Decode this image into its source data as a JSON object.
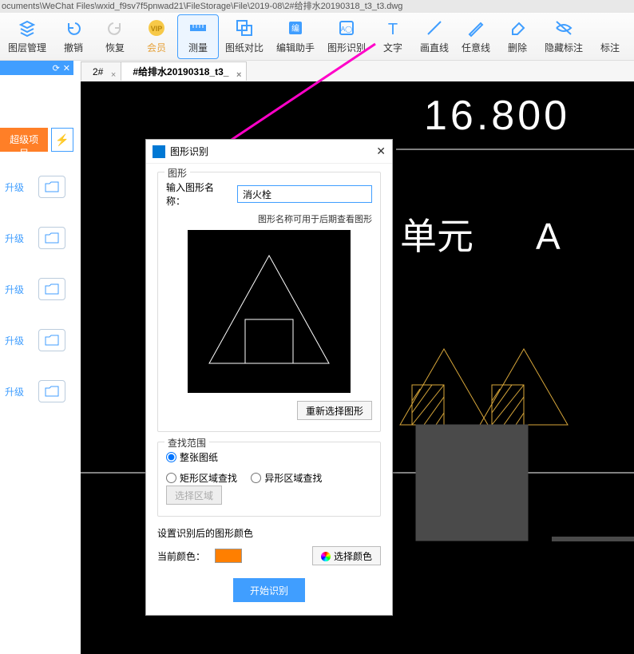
{
  "titlebar": "ocuments\\WeChat Files\\wxid_f9sv7f5pnwad21\\FileStorage\\File\\2019-08\\2#给排水20190318_t3_t3.dwg",
  "toolbar": {
    "layer": "图层管理",
    "undo": "撤销",
    "redo": "恢复",
    "vip": "会员",
    "measure": "测量",
    "compare": "图纸对比",
    "edit": "编辑助手",
    "recognize": "图形识别",
    "text": "文字",
    "line": "画直线",
    "freeline": "任意线",
    "delete": "删除",
    "hidenote": "隐藏标注",
    "mark": "标注"
  },
  "panel": {
    "pin": "📌",
    "close": "✕"
  },
  "side": {
    "super": "超级项目",
    "upgrade": "升级"
  },
  "tabs": {
    "t1": "2#",
    "t2": "#给排水20190318_t3_"
  },
  "canvas": {
    "num": "16.800",
    "unit": "单元",
    "letter": "A"
  },
  "dialog": {
    "title": "图形识别",
    "grp_shape": "图形",
    "name_label": "输入图形名称：",
    "name_value": "消火栓",
    "name_hint": "图形名称可用于后期查看图形",
    "reselect_btn": "重新选择图形",
    "grp_scope": "查找范围",
    "r_all": "整张图纸",
    "r_rect": "矩形区域查找",
    "r_irr": "异形区域查找",
    "select_area": "选择区域",
    "grp_color": "设置识别后的图形颜色",
    "cur_color": "当前颜色：",
    "pick_color": "选择颜色",
    "start": "开始识别"
  }
}
